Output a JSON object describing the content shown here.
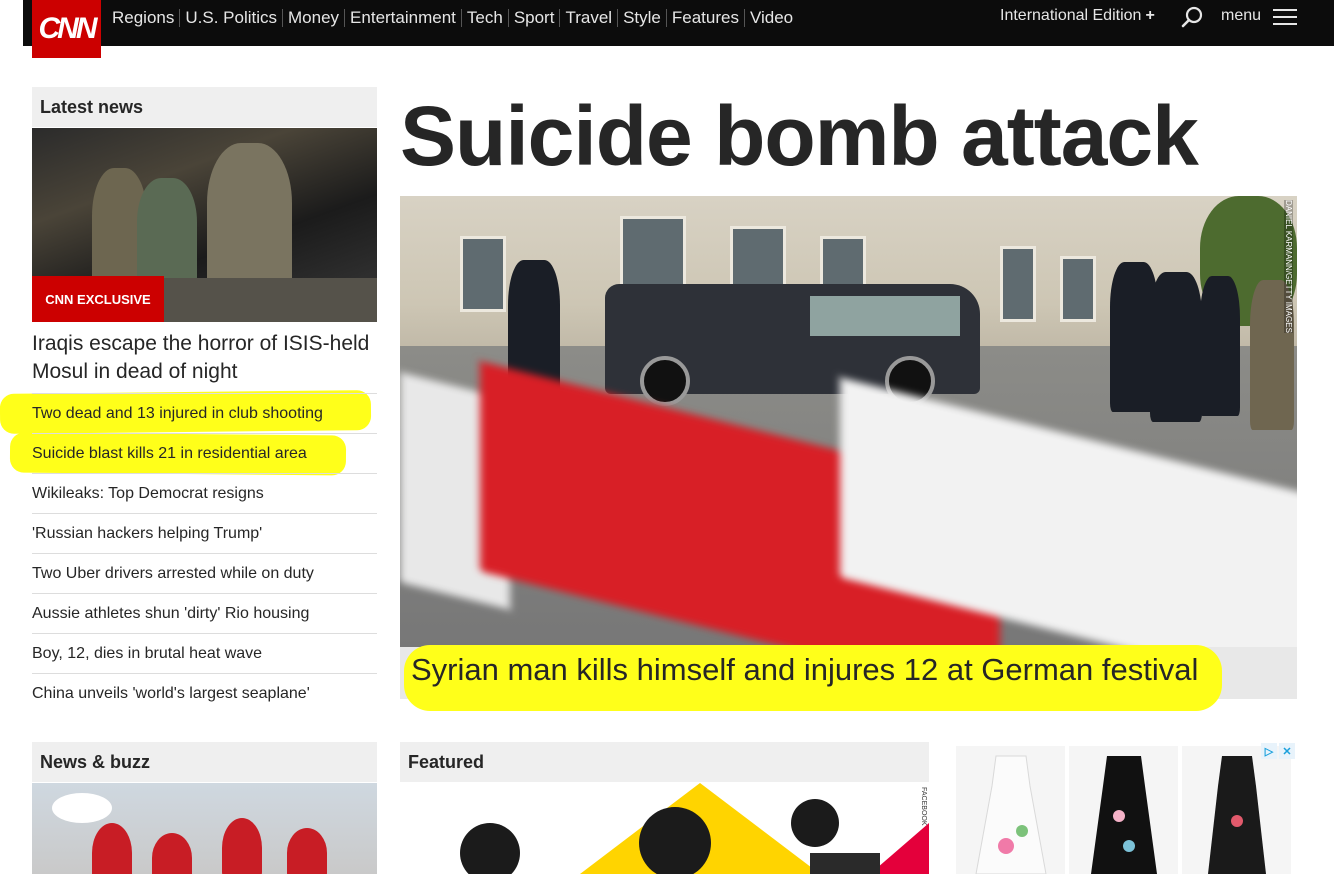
{
  "header": {
    "logo_text": "CNN",
    "nav_items": [
      "Regions",
      "U.S. Politics",
      "Money",
      "Entertainment",
      "Tech",
      "Sport",
      "Travel",
      "Style",
      "Features",
      "Video"
    ],
    "edition": "International Edition",
    "edition_plus": "+",
    "menu_label": "menu"
  },
  "latest_news": {
    "heading": "Latest news",
    "badge": "CNN EXCLUSIVE",
    "lead_story": "Iraqis escape the horror of ISIS-held Mosul in dead of night",
    "headlines": [
      "Two dead and 13 injured in club shooting",
      "Suicide blast kills 21 in residential area",
      "Wikileaks: Top Democrat resigns",
      "'Russian hackers helping Trump'",
      "Two Uber drivers arrested while on duty",
      "Aussie athletes shun 'dirty' Rio housing",
      "Boy, 12, dies in brutal heat wave",
      "China unveils 'world's largest seaplane'"
    ]
  },
  "main": {
    "title": "Suicide bomb attack",
    "image_credit": "DANIEL KARMANN/GETTY IMAGES",
    "caption": "Syrian man kills himself and injures 12 at German festival"
  },
  "news_buzz": {
    "heading": "News & buzz"
  },
  "featured": {
    "heading": "Featured",
    "image_credit": "FACEBOOK"
  },
  "ad": {
    "choices_icon": "▷",
    "close_icon": "✕"
  },
  "colors": {
    "brand_red": "#cc0000",
    "topbar": "#0c0c0c",
    "highlight": "#ffff1a"
  }
}
